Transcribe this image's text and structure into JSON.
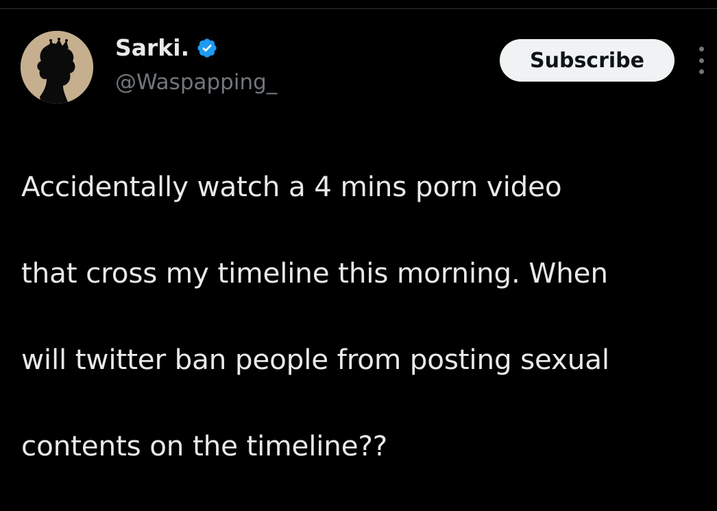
{
  "tweet": {
    "author": {
      "display_name": "Sarki.",
      "handle": "@Waspapping_",
      "verified": true
    },
    "subscribe_label": "Subscribe",
    "body_lines": [
      "Accidentally watch a 4 mins porn video",
      "that cross my timeline this morning. When",
      "will twitter ban people from posting sexual",
      "contents on the timeline??"
    ]
  },
  "icons": {
    "verified": "verified-badge-icon",
    "more": "more-vertical-icon",
    "avatar": "silhouette-with-crown-avatar"
  },
  "colors": {
    "background": "#000000",
    "text_primary": "#e7e9ea",
    "text_secondary": "#71767b",
    "verified_blue": "#1d9bf0",
    "button_bg": "#eff3f4",
    "button_text": "#0f1419"
  }
}
